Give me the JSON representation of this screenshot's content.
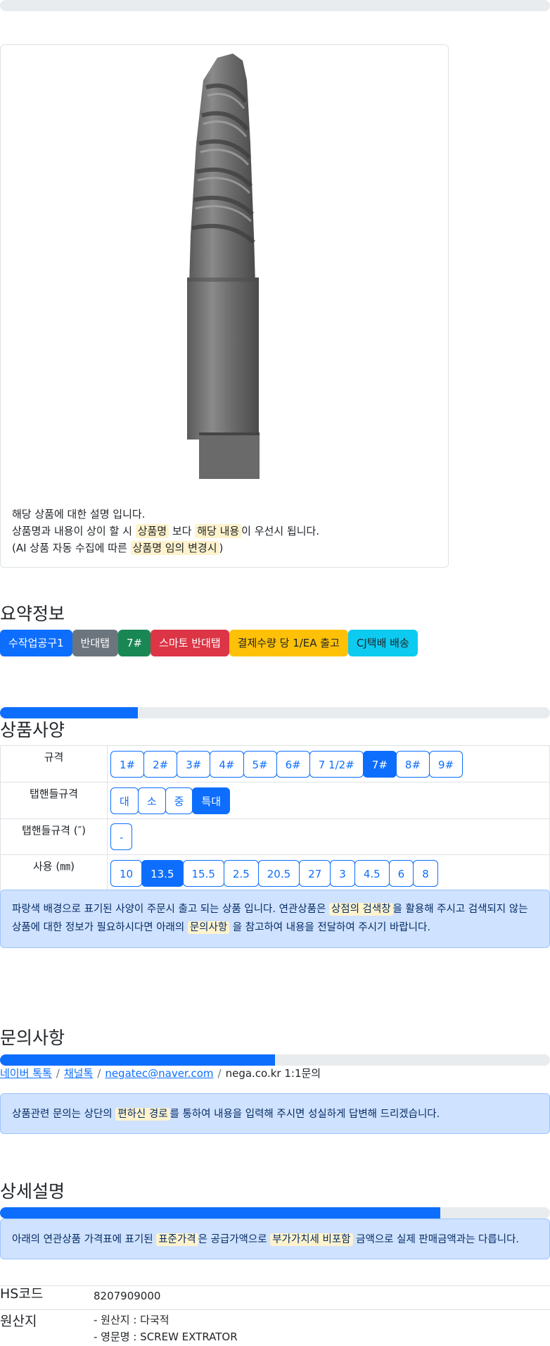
{
  "description": {
    "line1": "해당 상품에 대한 설명 입니다.",
    "line2_pre": "상품명과 내용이 상이 할 시 ",
    "line2_hl1": "상품명",
    "line2_mid": " 보다 ",
    "line2_hl2": "해당 내용",
    "line2_post": "이 우선시 됩니다.",
    "line3_pre": "(AI 상품 자동 수집에 따른 ",
    "line3_hl": "상품명 임의 변경시",
    "line3_post": ")"
  },
  "summary": {
    "title": "요약정보",
    "badges": [
      {
        "label": "수작업공구1",
        "color": "#0d6efd",
        "text_color": "#ffffff"
      },
      {
        "label": "반대탭",
        "color": "#6c757d",
        "text_color": "#ffffff"
      },
      {
        "label": "7#",
        "color": "#198754",
        "text_color": "#ffffff"
      },
      {
        "label": "스마토 반대탭",
        "color": "#dc3545",
        "text_color": "#ffffff"
      },
      {
        "label": "결제수량 당 1/EA 출고",
        "color": "#ffc107",
        "text_color": "#212529"
      },
      {
        "label": "CJ택배 배송",
        "color": "#0dcaf0",
        "text_color": "#212529"
      }
    ]
  },
  "spec": {
    "title": "상품사양",
    "progress_fraction": 0.25,
    "rows": [
      {
        "label": "규격",
        "options": [
          "1#",
          "2#",
          "3#",
          "4#",
          "5#",
          "6#",
          "7 1/2#",
          "7#",
          "8#",
          "9#"
        ],
        "selected": "7#"
      },
      {
        "label": "탭핸들규격",
        "options": [
          "대",
          "소",
          "중",
          "특대"
        ],
        "selected": "특대"
      },
      {
        "label": "탭핸들규격 (″)",
        "options": [
          "-"
        ],
        "selected": ""
      },
      {
        "label": "사용 (㎜)",
        "options": [
          "10",
          "13.5",
          "15.5",
          "2.5",
          "20.5",
          "27",
          "3",
          "4.5",
          "6",
          "8"
        ],
        "selected": "13.5"
      }
    ],
    "notice_pre": "파랑색 배경으로 표기된 사양이 주문시 출고 되는 상품 입니다. 연관상품은 ",
    "notice_hl1": "상점의 검색창",
    "notice_mid": "을 활용해 주시고 검색되지 않는 상품에 대한 정보가 필요하시다면 아래의 ",
    "notice_hl2": "문의사항",
    "notice_post": " 을 참고하여 내용을 전달하여 주시기 바랍니다."
  },
  "inquiry": {
    "title": "문의사항",
    "progress_fraction": 0.5,
    "links": [
      "네이버 톡톡",
      "채널톡",
      "negatec@naver.com"
    ],
    "plain": "nega.co.kr 1:1문의",
    "notice_pre": "상품관련 문의는 상단의 ",
    "notice_hl": "편하신 경로",
    "notice_post": "를 통하여 내용을 입력해 주시면 성실하게 답변해 드리겠습니다."
  },
  "detail": {
    "title": "상세설명",
    "progress_fraction": 0.8,
    "notice_pre": "아래의 연관상품 가격표에 표기된 ",
    "notice_hl1": "표준가격",
    "notice_mid": "은 공급가액으로 ",
    "notice_hl2": "부가가치세 비포함",
    "notice_post": " 금액으로 실제 판매금액과는 다릅니다.",
    "hs_label": "HS코드",
    "hs_value": "8207909000",
    "origin_label": "원산지",
    "origin_line1": "- 원산지 : 다국적",
    "origin_line2": "- 영문명 : SCREW EXTRATOR"
  }
}
